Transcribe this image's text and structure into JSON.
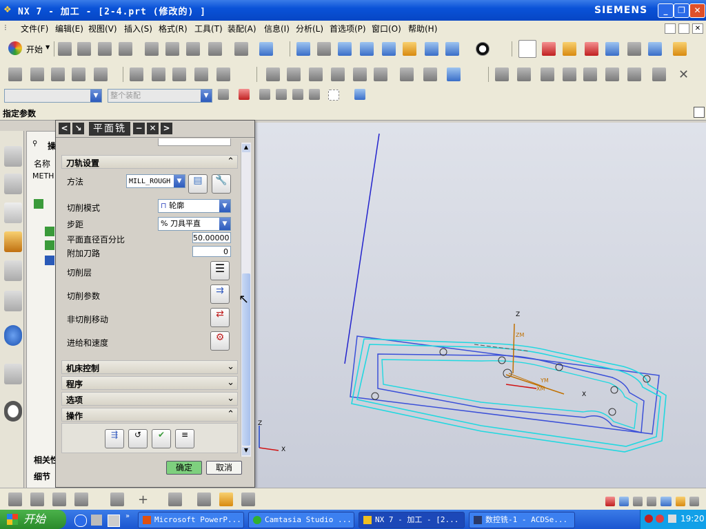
{
  "window": {
    "title": "NX 7 - 加工 - [2-4.prt (修改的) ]",
    "brand": "SIEMENS",
    "buttons": {
      "minimize": "_",
      "restore": "❐",
      "close": "✕"
    }
  },
  "menu": [
    "文件(F)",
    "编辑(E)",
    "视图(V)",
    "插入(S)",
    "格式(R)",
    "工具(T)",
    "装配(A)",
    "信息(I)",
    "分析(L)",
    "首选项(P)",
    "窗口(O)",
    "帮助(H)"
  ],
  "toolbar": {
    "start_label": "开始",
    "selection_filter_placeholder": "整个装配"
  },
  "status": {
    "prompt": "指定参数"
  },
  "navigator": {
    "header": "操",
    "column_name": "名称",
    "method_abbrev": "METH",
    "bottom_tab_related": "相关性",
    "bottom_tab_details": "细节"
  },
  "dialog": {
    "title": "平面铣",
    "header_buttons": {
      "collapse": "<",
      "reset": "↘",
      "minus": "−",
      "close": "✕",
      "expand": ">"
    },
    "sections": {
      "path_settings": "刀轨设置",
      "machine_control": "机床控制",
      "program": "程序",
      "options": "选项",
      "actions": "操作"
    },
    "fields": {
      "method_label": "方法",
      "method_value": "MILL_ROUGH",
      "cut_pattern_label": "切削模式",
      "cut_pattern_value": "轮廓",
      "stepover_label": "步距",
      "stepover_value": "% 刀具平直",
      "flat_diameter_label": "平面直径百分比",
      "flat_diameter_value": "50.00000",
      "additional_passes_label": "附加刀路",
      "additional_passes_value": "0",
      "cut_levels_label": "切削层",
      "cut_params_label": "切削参数",
      "non_cutting_label": "非切削移动",
      "feeds_speeds_label": "进给和速度"
    },
    "ok_label": "确定",
    "cancel_label": "取消"
  },
  "viewport": {
    "axis_z": "Z",
    "axis_x": "X",
    "axis_y": "Y",
    "wcs_label_zm": "ZM",
    "wcs_label_xm": "XM",
    "wcs_label_ym": "YM"
  },
  "taskbar": {
    "start": "开始",
    "tasks": [
      "Microsoft PowerP...",
      "Camtasia Studio ...",
      "NX 7 - 加工 - [2...",
      "数控铣-1 - ACDSe..."
    ],
    "clock": "19:20"
  },
  "colors": {
    "title_blue": "#0a52d8",
    "part_outline": "#3a4fd8",
    "toolpath": "#20d8e0",
    "wcs_orange": "#c07000",
    "ok_green": "#7ed07e"
  }
}
